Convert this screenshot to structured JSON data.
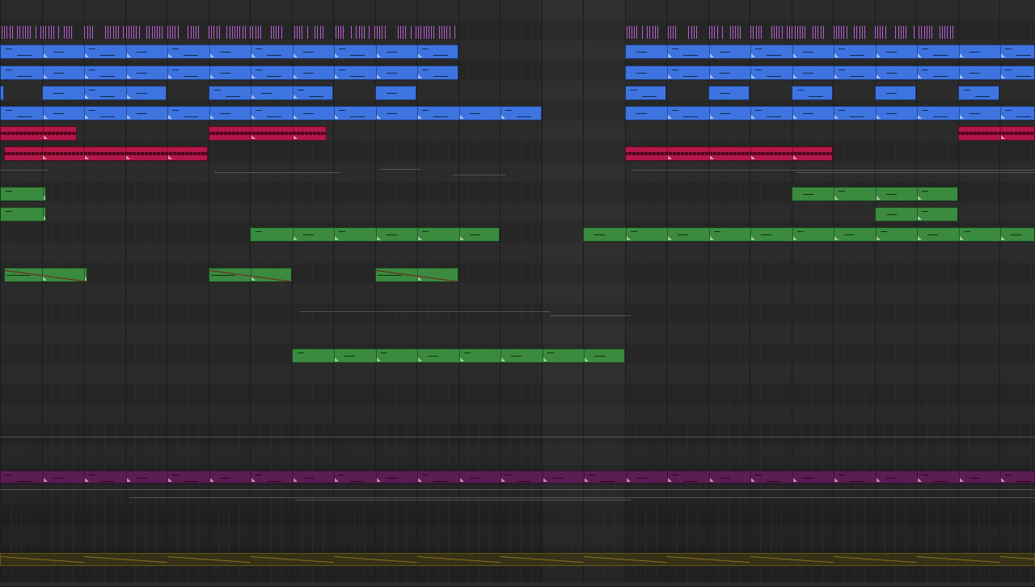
{
  "colors": {
    "background": "#262626",
    "lane_alt": "#2b2b2b",
    "lane_dark": "#232323",
    "grid_beat": "#303030",
    "grid_bar": "#1b1b1b",
    "midi_blue": "#3e74e0",
    "audio_red": "#b51748",
    "green": "#3a8a3f",
    "drum_purple": "#b55fd0",
    "pad_purple": "#5c1c54",
    "automation_olive": "#4a3f10"
  },
  "timeline": {
    "bars_visible": 25,
    "empty_gap_bars": [
      13,
      14
    ]
  },
  "tracks": [
    {
      "id": "drums",
      "type": "midi-drum",
      "color": "drum_purple",
      "clips_bars": [
        [
          0,
          11
        ],
        [
          15,
          23
        ]
      ]
    },
    {
      "id": "bass-1",
      "type": "midi",
      "color": "midi_blue",
      "clips_bars": [
        [
          0,
          11
        ],
        [
          15,
          25
        ]
      ]
    },
    {
      "id": "bass-2",
      "type": "midi",
      "color": "midi_blue",
      "clips_bars": [
        [
          0,
          11
        ],
        [
          15,
          25
        ]
      ]
    },
    {
      "id": "keys",
      "type": "midi",
      "color": "midi_blue",
      "clips_bars": [
        [
          0,
          0.1
        ],
        [
          1,
          4
        ],
        [
          5,
          8
        ],
        [
          9,
          10
        ],
        [
          15,
          16
        ],
        [
          17,
          18
        ],
        [
          19,
          20
        ],
        [
          21,
          22
        ],
        [
          23,
          24
        ]
      ]
    },
    {
      "id": "pad",
      "type": "midi",
      "color": "midi_blue",
      "clips_bars": [
        [
          0,
          13
        ],
        [
          15,
          25
        ]
      ]
    },
    {
      "id": "vocal-1",
      "type": "audio",
      "color": "audio_red",
      "clips_bars": [
        [
          0,
          1.85
        ],
        [
          5,
          7.85
        ],
        [
          23,
          25
        ]
      ]
    },
    {
      "id": "vocal-2",
      "type": "audio",
      "color": "audio_red",
      "clips_bars": [
        [
          0.1,
          5
        ],
        [
          15,
          20
        ]
      ]
    },
    {
      "id": "fx-1",
      "type": "audio",
      "color": "green",
      "clips_bars": [
        [
          0,
          1.1
        ],
        [
          19,
          23
        ]
      ]
    },
    {
      "id": "fx-2",
      "type": "audio",
      "color": "green",
      "clips_bars": [
        [
          0,
          1.1
        ],
        [
          21,
          23
        ]
      ]
    },
    {
      "id": "fx-3",
      "type": "audio",
      "color": "green",
      "clips_bars": [
        [
          6,
          12
        ],
        [
          14,
          25
        ]
      ]
    },
    {
      "id": "riser",
      "type": "audio",
      "color": "green",
      "clips_bars": [
        [
          0.1,
          2.1
        ],
        [
          5,
          7
        ],
        [
          9,
          11
        ]
      ]
    },
    {
      "id": "sweep",
      "type": "audio",
      "color": "green",
      "clips_bars": [
        [
          7,
          15
        ]
      ]
    },
    {
      "id": "sub-pad",
      "type": "midi",
      "color": "pad_purple",
      "clips_bars": [
        [
          0,
          25
        ]
      ]
    },
    {
      "id": "master-automation",
      "type": "automation",
      "color": "automation_olive",
      "clips_bars": [
        [
          0,
          25
        ]
      ]
    }
  ]
}
